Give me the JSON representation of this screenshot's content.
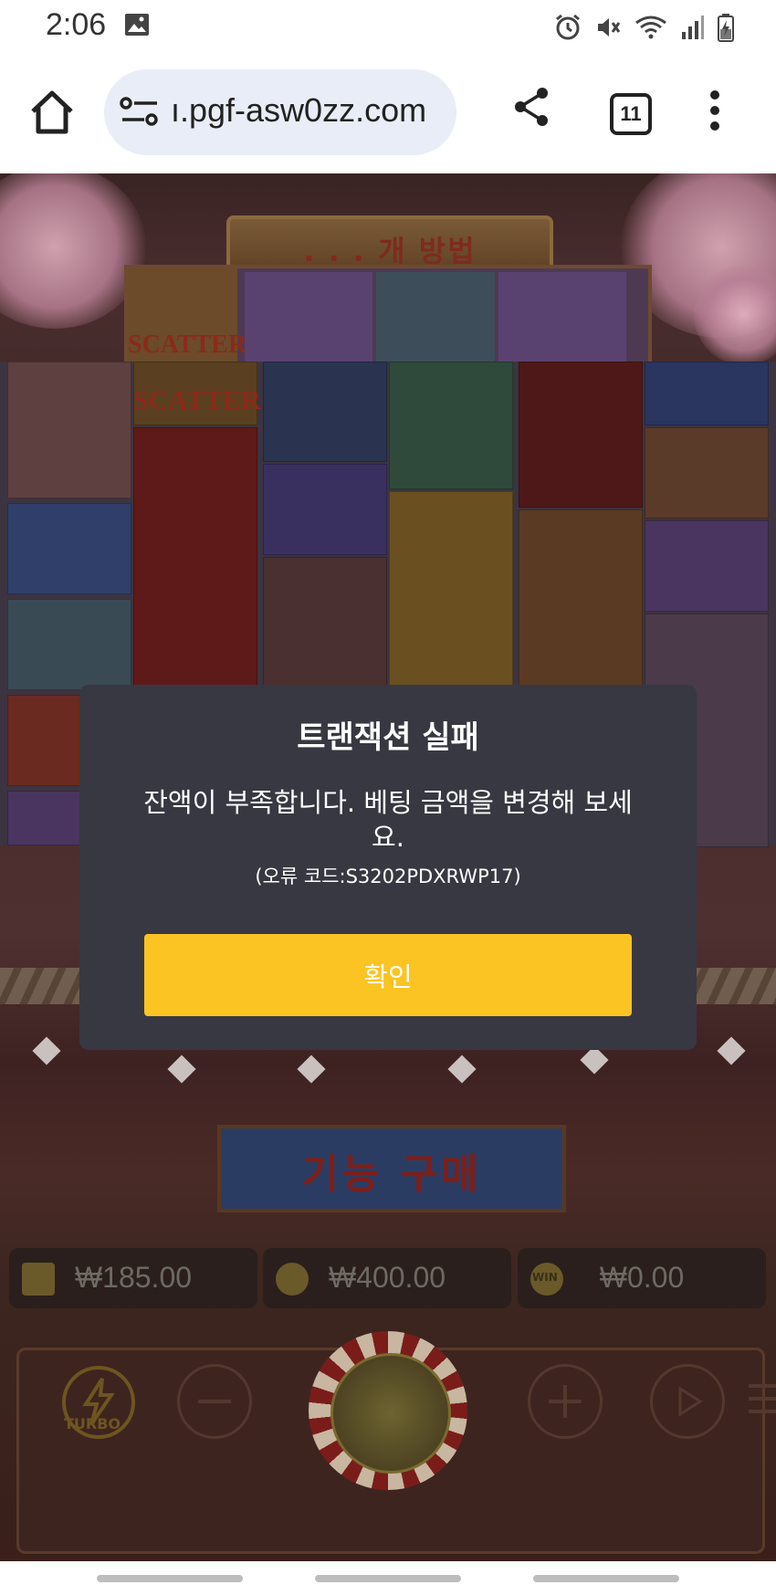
{
  "status_bar": {
    "time": "2:06",
    "icons": [
      "image-icon",
      "alarm-icon",
      "mute-icon",
      "wifi-icon",
      "signal-icon",
      "battery-charging-icon"
    ]
  },
  "browser": {
    "url": "ı.pgf-asw0zz.com",
    "tab_count": "11",
    "icons": [
      "home-icon",
      "site-settings-icon",
      "share-icon",
      "tabs-icon",
      "more-vert-icon"
    ]
  },
  "game": {
    "ways_label": ". . .  개 방법",
    "scatter_label": "SCATTER",
    "feature_buy_label": "기능 구매",
    "balance": "₩185.00",
    "bet": "₩400.00",
    "win": "₩0.00",
    "turbo_label": "TURBO",
    "win_badge": "WIN"
  },
  "dialog": {
    "title": "트랜잭션 실패",
    "message": "잔액이 부족합니다. 베팅 금액을 변경해 보세요.",
    "error_code": "(오류 코드:S3202PDXRWP17)",
    "confirm_label": "확인"
  },
  "colors": {
    "confirm_button": "#fcc422",
    "dialog_bg": "#383842",
    "url_bar_bg": "#e8edf7"
  }
}
